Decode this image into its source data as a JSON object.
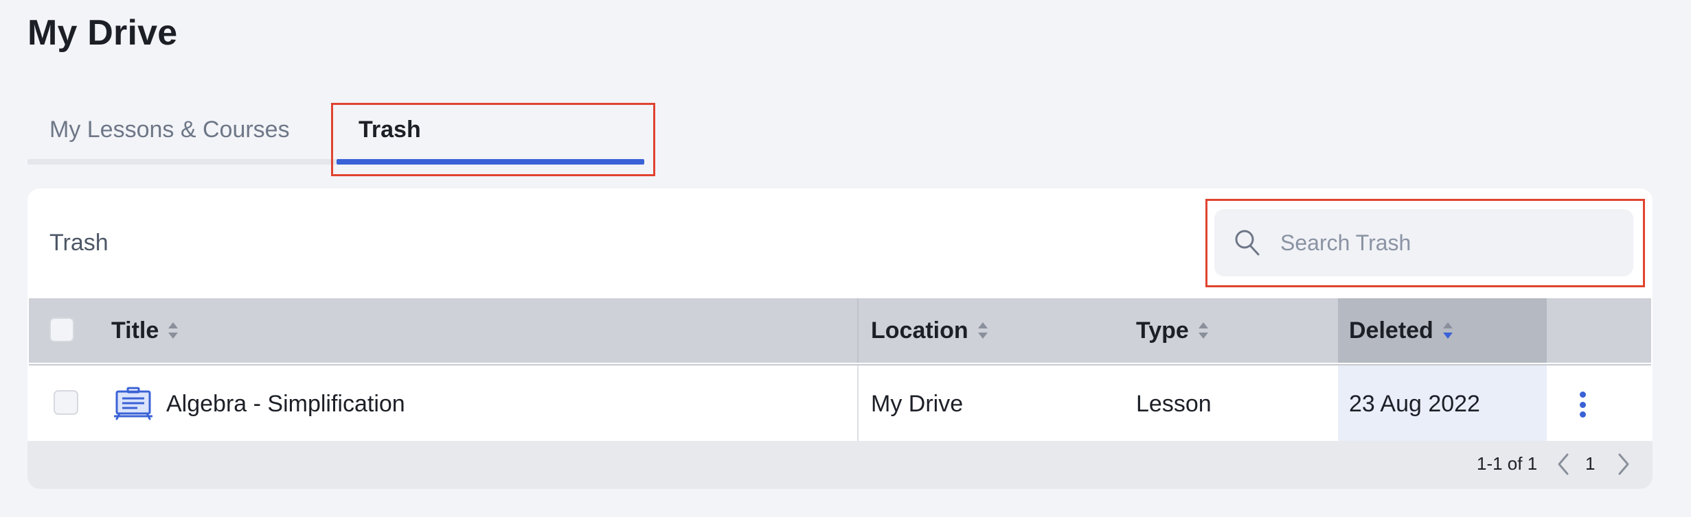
{
  "page": {
    "title": "My Drive"
  },
  "tabs": [
    {
      "label": "My Lessons & Courses",
      "active": false
    },
    {
      "label": "Trash",
      "active": true
    }
  ],
  "panel": {
    "title": "Trash",
    "search": {
      "placeholder": "Search Trash",
      "value": ""
    }
  },
  "table": {
    "columns": [
      {
        "label": "Title",
        "sort": "none"
      },
      {
        "label": "Location",
        "sort": "none"
      },
      {
        "label": "Type",
        "sort": "none"
      },
      {
        "label": "Deleted",
        "sort": "descending"
      }
    ],
    "rows": [
      {
        "icon": "lesson-board-icon",
        "title": "Algebra - Simplification",
        "location": "My Drive",
        "type": "Lesson",
        "deleted": "23 Aug 2022"
      }
    ]
  },
  "pagination": {
    "range": "1-1 of 1",
    "page": "1"
  },
  "colors": {
    "accent": "#3a62d6",
    "highlight_box": "#e0432f",
    "header_bg": "#ced1d7",
    "sorted_header_bg": "#b5b9c2",
    "sorted_cell_bg": "#e9eef9"
  }
}
